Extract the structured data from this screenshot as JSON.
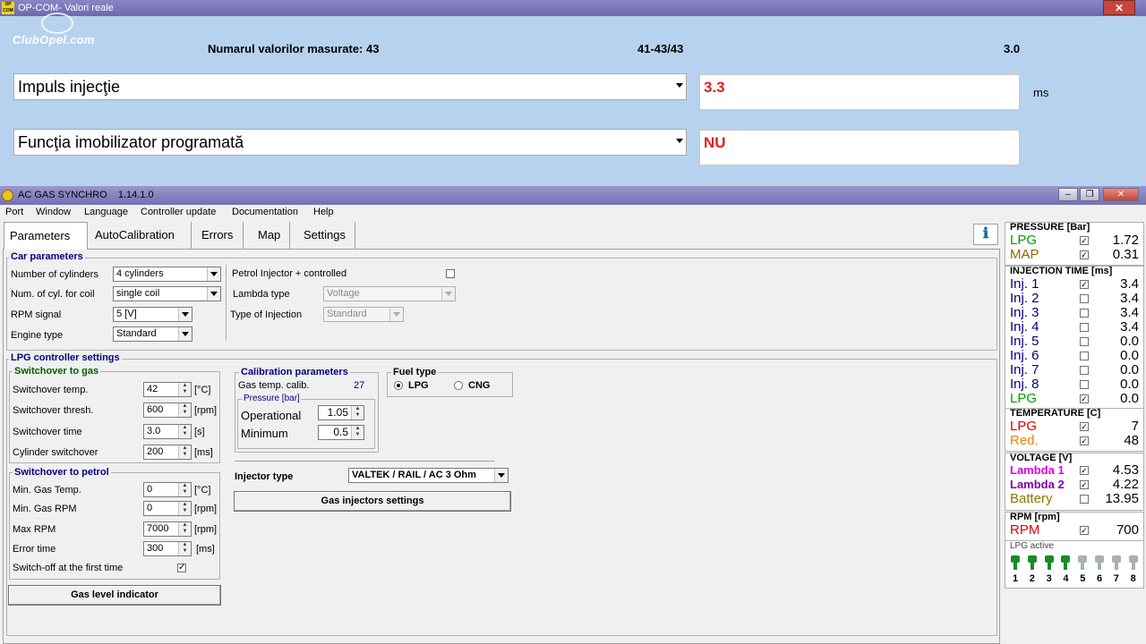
{
  "opcom": {
    "title": "OP-COM- Valori reale",
    "title_tail": "",
    "logo": "ClubOpel.com",
    "header_count": "Numarul valorilor masurate: 43",
    "header_range": "41-43/43",
    "header_version": "3.0",
    "rows": [
      {
        "name": "Impuls injecţie",
        "value": "3.3",
        "unit": "ms"
      },
      {
        "name": "Funcţia imobilizator programată",
        "value": "NU",
        "unit": ""
      }
    ]
  },
  "ac": {
    "title": "AC GAS SYNCHRO    1.14.1.0",
    "menu": [
      "Port",
      "Window",
      "Language",
      "Controller update",
      "Documentation",
      "Help"
    ],
    "tabs": [
      "Parameters",
      "AutoCalibration",
      "Errors",
      "Map",
      "Settings"
    ],
    "car": {
      "title": "Car parameters",
      "cyl_label": "Number of cylinders",
      "cyl_value": "4 cylinders",
      "coil_label": "Num. of cyl. for coil",
      "coil_value": "single coil",
      "rpm_label": "RPM signal",
      "rpm_value": "5 [V]",
      "engine_label": "Engine type",
      "engine_value": "Standard",
      "petrol_label": "Petrol Injector + controlled",
      "lambda_label": "Lambda type",
      "lambda_value": "Voltage",
      "inj_type_label": "Type of Injection",
      "inj_type_value": "Standard"
    },
    "lpg": {
      "title": "LPG controller settings",
      "to_gas_title": "Switchover to gas",
      "sw_temp_label": "Switchover temp.",
      "sw_temp": "42",
      "sw_temp_unit": "[°C]",
      "sw_thresh_label": "Switchover thresh.",
      "sw_thresh": "600",
      "sw_thresh_unit": "[rpm]",
      "sw_time_label": "Switchover time",
      "sw_time": "3.0",
      "sw_time_unit": "[s]",
      "cyl_sw_label": "Cylinder switchover",
      "cyl_sw": "200",
      "cyl_sw_unit": "[ms]",
      "to_petrol_title": "Switchover to petrol",
      "min_temp_label": "Min. Gas Temp.",
      "min_temp": "0",
      "min_temp_unit": "[°C]",
      "min_rpm_label": "Min. Gas RPM",
      "min_rpm": "0",
      "min_rpm_unit": "[rpm]",
      "max_rpm_label": "Max RPM",
      "max_rpm": "7000",
      "max_rpm_unit": "[rpm]",
      "err_time_label": "Error time",
      "err_time": "300",
      "err_time_unit": "[ms]",
      "switchoff_label": "Switch-off at the first time",
      "gas_level_btn": "Gas level indicator",
      "calib_title": "Calibration parameters",
      "gas_temp_label": "Gas temp. calib.",
      "gas_temp": "27",
      "pressure_title": "Pressure [bar]",
      "operational_label": "Operational",
      "operational": "1.05",
      "minimum_label": "Minimum",
      "minimum": "0.5",
      "fuel_title": "Fuel type",
      "fuel_lpg": "LPG",
      "fuel_cng": "CNG",
      "injector_type_label": "Injector type",
      "injector_type": "VALTEK / RAIL / AC 3 Ohm",
      "gas_inj_btn": "Gas injectors settings"
    }
  },
  "panel": {
    "pressure_title": "PRESSURE [Bar]",
    "pressure": [
      {
        "name": "LPG",
        "value": "1.72",
        "color": "#00a000",
        "checked": true
      },
      {
        "name": "MAP",
        "value": "0.31",
        "color": "#8a6a00",
        "checked": true
      }
    ],
    "inj_title": "INJECTION TIME [ms]",
    "inj": [
      {
        "name": "Inj. 1",
        "value": "3.4",
        "color": "#000080",
        "checked": true
      },
      {
        "name": "Inj. 2",
        "value": "3.4",
        "color": "#000080",
        "checked": false
      },
      {
        "name": "Inj. 3",
        "value": "3.4",
        "color": "#000080",
        "checked": false
      },
      {
        "name": "Inj. 4",
        "value": "3.4",
        "color": "#000080",
        "checked": false
      },
      {
        "name": "Inj. 5",
        "value": "0.0",
        "color": "#000080",
        "checked": false
      },
      {
        "name": "Inj. 6",
        "value": "0.0",
        "color": "#000080",
        "checked": false
      },
      {
        "name": "Inj. 7",
        "value": "0.0",
        "color": "#000080",
        "checked": false
      },
      {
        "name": "Inj. 8",
        "value": "0.0",
        "color": "#000080",
        "checked": false
      },
      {
        "name": "LPG",
        "value": "0.0",
        "color": "#00a000",
        "checked": true
      }
    ],
    "temp_title": "TEMPERATURE  [C]",
    "temp": [
      {
        "name": "LPG",
        "value": "7",
        "color": "#e00000",
        "checked": true
      },
      {
        "name": "Red.",
        "value": "48",
        "color": "#f08000",
        "checked": true
      }
    ],
    "volt_title": "VOLTAGE [V]",
    "volt": [
      {
        "name": "Lambda 1",
        "value": "4.53",
        "color": "#e000e0",
        "checked": true
      },
      {
        "name": "Lambda 2",
        "value": "4.22",
        "color": "#8000a0",
        "checked": true
      },
      {
        "name": "Battery",
        "value": "13.95",
        "color": "#8a7a00",
        "checked": false
      }
    ],
    "rpm_title": "RPM [rpm]",
    "rpm": [
      {
        "name": "RPM",
        "value": "700",
        "color": "#e00000",
        "checked": true
      }
    ],
    "lpg_active_title": "LPG active",
    "injectors": [
      {
        "n": "1",
        "active": true
      },
      {
        "n": "2",
        "active": true
      },
      {
        "n": "3",
        "active": true
      },
      {
        "n": "4",
        "active": true
      },
      {
        "n": "5",
        "active": false
      },
      {
        "n": "6",
        "active": false
      },
      {
        "n": "7",
        "active": false
      },
      {
        "n": "8",
        "active": false
      }
    ]
  }
}
